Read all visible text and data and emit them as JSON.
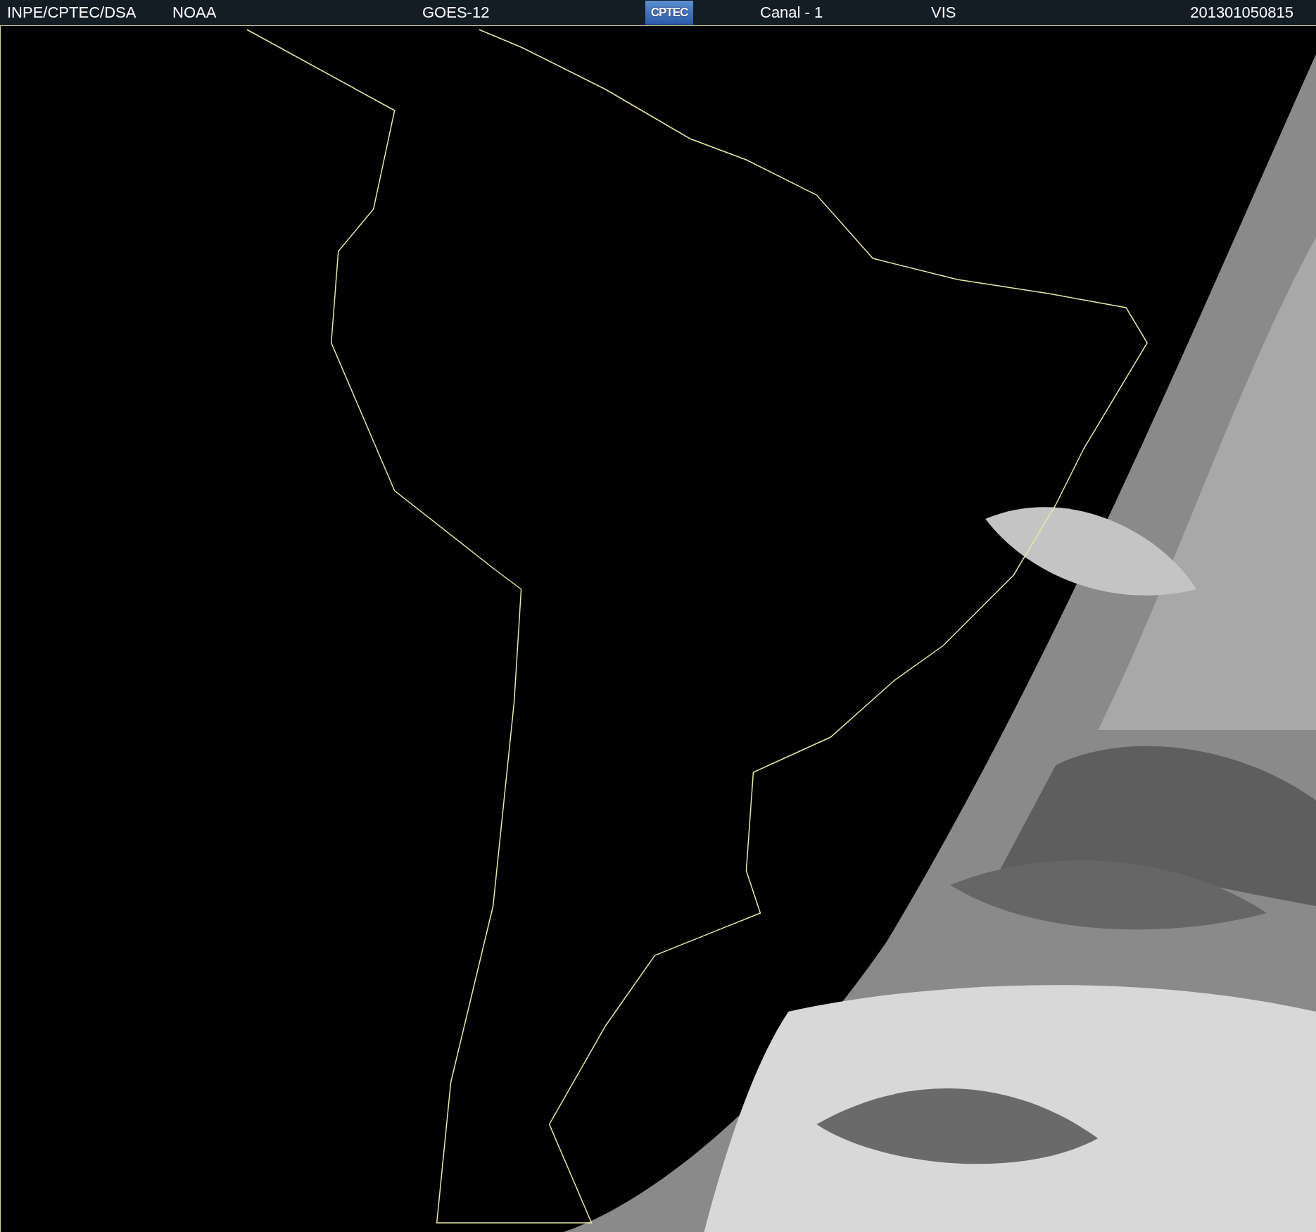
{
  "header": {
    "source": "INPE/CPTEC/DSA",
    "agency": "NOAA",
    "satellite": "GOES-12",
    "logo": "CPTEC",
    "channel": "Canal - 1",
    "band": "VIS",
    "timestamp": "201301050815"
  }
}
